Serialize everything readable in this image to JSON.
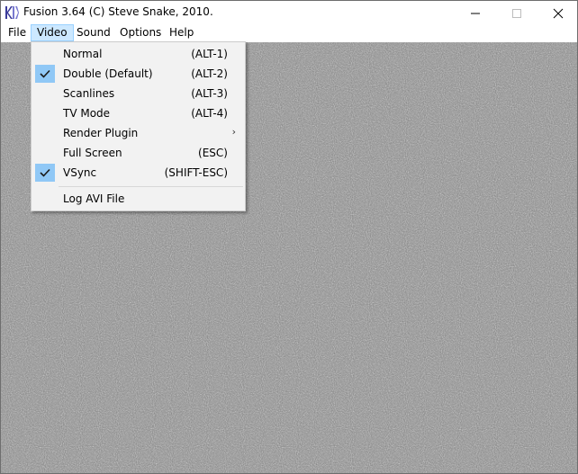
{
  "window": {
    "title": "Fusion 3.64 (C) Steve Snake, 2010."
  },
  "menubar": {
    "items": [
      {
        "label": "File"
      },
      {
        "label": "Video"
      },
      {
        "label": "Sound"
      },
      {
        "label": "Options"
      },
      {
        "label": "Help"
      }
    ]
  },
  "video_menu": {
    "items": [
      {
        "label": "Normal",
        "shortcut": "(ALT-1)",
        "checked": false
      },
      {
        "label": "Double (Default)",
        "shortcut": "(ALT-2)",
        "checked": true
      },
      {
        "label": "Scanlines",
        "shortcut": "(ALT-3)",
        "checked": false
      },
      {
        "label": "TV Mode",
        "shortcut": "(ALT-4)",
        "checked": false
      },
      {
        "label": "Render Plugin",
        "shortcut": "",
        "checked": false,
        "submenu": true
      },
      {
        "label": "Full Screen",
        "shortcut": "(ESC)",
        "checked": false
      },
      {
        "label": "VSync",
        "shortcut": "(SHIFT-ESC)",
        "checked": true
      },
      {
        "label": "Log AVI File",
        "shortcut": "",
        "checked": false
      }
    ]
  },
  "colors": {
    "menu_highlight": "#cce8ff",
    "check_highlight": "#90c8f6",
    "static_noise_base": "#808080"
  },
  "icons": {
    "app": "fusion-app-icon",
    "minimize": "minimize-icon",
    "maximize": "maximize-icon",
    "close": "close-icon",
    "check": "checkmark-icon",
    "submenu": "chevron-right-icon"
  }
}
